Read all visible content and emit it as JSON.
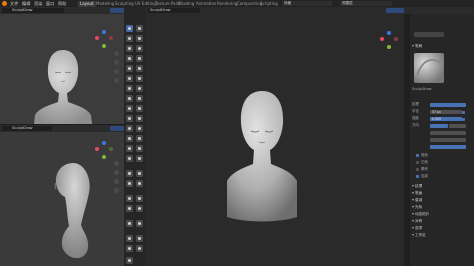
{
  "app": {
    "menu": [
      "文件",
      "编辑",
      "渲染",
      "窗口",
      "帮助"
    ],
    "workspace_tabs": [
      "Layout",
      "Modeling",
      "Sculpting",
      "UV Editing",
      "Texture Paint",
      "Shading",
      "Animation",
      "Rendering",
      "Compositing",
      "Scripting"
    ],
    "active_tab": "Layout",
    "scene_name": "场景",
    "view_layer": "视图层"
  },
  "viewport_top_left": {
    "mode_label": "SculptDraw"
  },
  "viewport_bottom_left": {
    "mode_label": "SculptDraw"
  },
  "viewport_main": {
    "mode_label": "SculptDraw"
  },
  "properties": {
    "brush_name": "SculptDraw",
    "texture_label": "纹理",
    "radius_label": "半径",
    "radius_value": "57 px",
    "strength_label": "强度",
    "strength_value": "0.500",
    "direction_label": "方向",
    "sections": [
      "笔刷",
      "纹理",
      "笔画",
      "衰减",
      "光标",
      "动态拓扑",
      "对称",
      "选项",
      "工作区"
    ],
    "checkbox_labels": [
      "前面",
      "正面",
      "累积",
      "加减"
    ]
  },
  "colors": {
    "accent": "#4772b3",
    "axis_x": "#e84a5f",
    "axis_y": "#7fba3a",
    "axis_z": "#3a78e0",
    "viewport_bg": "#3a3a3a",
    "mesh": "#bdbdbd"
  }
}
